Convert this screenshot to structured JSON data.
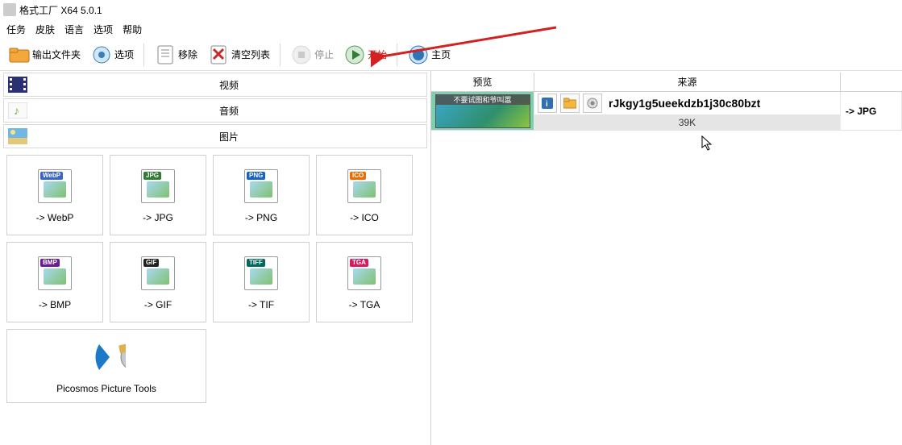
{
  "title": "格式工厂 X64 5.0.1",
  "menu": {
    "task": "任务",
    "skin": "皮肤",
    "lang": "语言",
    "opts": "选项",
    "help": "帮助"
  },
  "toolbar": {
    "output": "输出文件夹",
    "options": "选项",
    "remove": "移除",
    "clear": "清空列表",
    "stop": "停止",
    "start": "开始",
    "home": "主页"
  },
  "categories": {
    "video": "视频",
    "audio": "音频",
    "picture": "图片"
  },
  "formats": {
    "webp": "-> WebP",
    "jpg": "-> JPG",
    "png": "-> PNG",
    "ico": "-> ICO",
    "bmp": "-> BMP",
    "gif": "-> GIF",
    "tif": "-> TIF",
    "tga": "-> TGA",
    "picosmos": "Picosmos Picture Tools"
  },
  "badges": {
    "webp": "WebP",
    "jpg": "JPG",
    "png": "PNG",
    "ico": "ICO",
    "bmp": "BMP",
    "gif": "GIF",
    "tif": "TIFF",
    "tga": "TGA"
  },
  "badgeColors": {
    "webp": "#3a66c8",
    "jpg": "#2e7d32",
    "png": "#1565c0",
    "ico": "#ef6c00",
    "bmp": "#6a1b9a",
    "gif": "#212121",
    "tif": "#00695c",
    "tga": "#d81b60"
  },
  "rightHeader": {
    "preview": "预览",
    "source": "来源",
    "output": ""
  },
  "item": {
    "caption": "不要试图和爷叫嚣",
    "filename": "rJkgy1g5ueekdzb1j30c80bzt",
    "size": "39K",
    "target": "-> JPG"
  }
}
